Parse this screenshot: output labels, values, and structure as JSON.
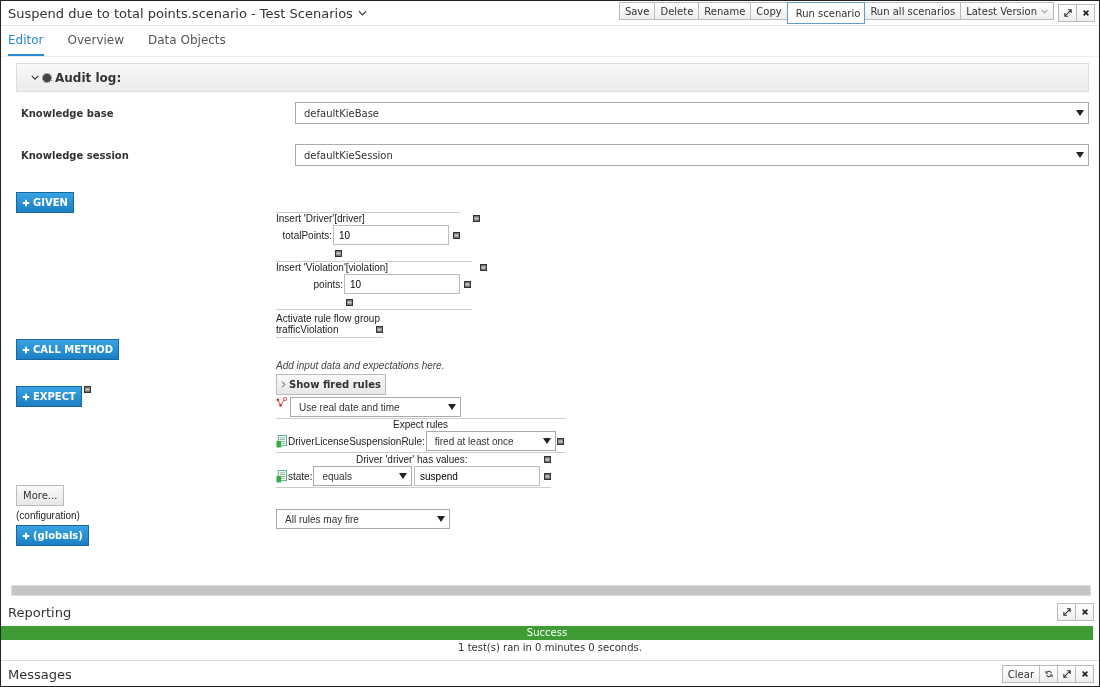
{
  "window": {
    "title": "Suspend due to total points.scenario - Test Scenarios"
  },
  "toolbar": {
    "buttons": [
      {
        "label": "Save",
        "selected": false
      },
      {
        "label": "Delete",
        "selected": false
      },
      {
        "label": "Rename",
        "selected": false
      },
      {
        "label": "Copy",
        "selected": false
      },
      {
        "label": "Run scenario",
        "selected": true
      },
      {
        "label": "Run all scenarios",
        "selected": false
      }
    ],
    "version": "Latest Version"
  },
  "tabs": [
    {
      "label": "Editor",
      "selected": true
    },
    {
      "label": "Overview",
      "selected": false
    },
    {
      "label": "Data Objects",
      "selected": false
    }
  ],
  "audit_log": {
    "label": "Audit log:",
    "expanded": true
  },
  "settings": [
    {
      "label": "Knowledge base",
      "value": "defaultKieBase"
    },
    {
      "label": "Knowledge session",
      "value": "defaultKieSession"
    }
  ],
  "given": {
    "button": "GIVEN",
    "facts": [
      {
        "title": "Insert 'Driver'[driver]",
        "fields": [
          {
            "name": "totalPoints:",
            "value": "10"
          }
        ]
      },
      {
        "title": "Insert 'Violation'[violation]",
        "fields": [
          {
            "name": "points:",
            "value": "10"
          }
        ]
      }
    ],
    "rule_flow": [
      "Activate rule flow group",
      "trafficViolation"
    ]
  },
  "call_method": {
    "button": "CALL METHOD"
  },
  "expect": {
    "button": "EXPECT",
    "hint": "Add input data and expectations here.",
    "show_fired": "Show fired rules",
    "date_mode": "Use real date and time",
    "rules_heading": "Expect rules",
    "rules": [
      {
        "name": "DriverLicenseSuspensionRule:",
        "mode": "fired at least once"
      }
    ],
    "fact_heading": "Driver 'driver' has values:",
    "fields": [
      {
        "name": "state:",
        "operator": "equals",
        "value": "suspend"
      }
    ]
  },
  "more": {
    "button": "More...",
    "config": "(configuration)",
    "globals": "(globals)",
    "firing": "All rules may fire"
  },
  "reporting": {
    "title": "Reporting",
    "status": "Success",
    "summary": "1 test(s) ran in 0 minutes 0 seconds."
  },
  "messages": {
    "title": "Messages",
    "clear": "Clear"
  }
}
